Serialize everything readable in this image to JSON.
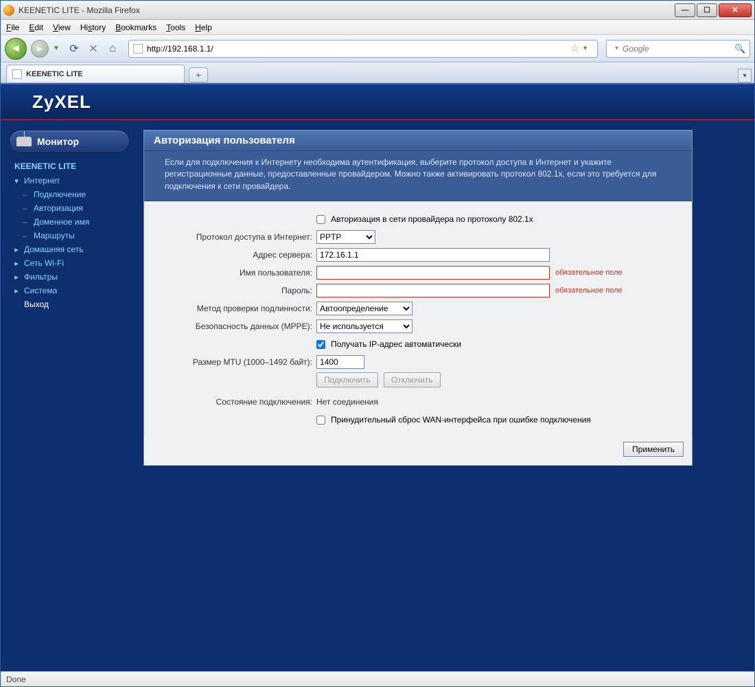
{
  "window": {
    "title": "KEENETIC LITE - Mozilla Firefox",
    "min": "—",
    "max": "☐",
    "close": "✕"
  },
  "menubar": [
    "File",
    "Edit",
    "View",
    "History",
    "Bookmarks",
    "Tools",
    "Help"
  ],
  "navbar": {
    "url": "http://192.168.1.1/",
    "search_placeholder": "Google"
  },
  "tab": {
    "title": "KEENETIC LITE",
    "add": "+"
  },
  "brand": "ZyXEL",
  "sidebar": {
    "monitor": "Монитор",
    "root": "KEENETIC LITE",
    "items": [
      {
        "label": "Интернет",
        "type": "branch",
        "expanded": true
      },
      {
        "label": "Подключение",
        "type": "leaf"
      },
      {
        "label": "Авторизация",
        "type": "leaf",
        "active": true
      },
      {
        "label": "Доменное имя",
        "type": "leaf"
      },
      {
        "label": "Маршруты",
        "type": "leaf"
      },
      {
        "label": "Домашняя сеть",
        "type": "branch"
      },
      {
        "label": "Сеть Wi-Fi",
        "type": "branch"
      },
      {
        "label": "Фильтры",
        "type": "branch"
      },
      {
        "label": "Система",
        "type": "branch"
      },
      {
        "label": "Выход",
        "type": "plain"
      }
    ]
  },
  "panel": {
    "title": "Авторизация пользователя",
    "desc": "Если для подключения к Интернету необходима аутентификация, выберите протокол доступа в Интернет и укажите регистрационные данные, предоставленные провайдером. Можно также активировать протокол 802.1x, если это требуется для подключения к сети провайдера."
  },
  "form": {
    "chk_8021x_label": "Авторизация в сети провайдера по протоколу 802.1x",
    "protocol_label": "Протокол доступа в Интернет:",
    "protocol_value": "PPTP",
    "server_label": "Адрес сервера:",
    "server_value": "172.16.1.1",
    "username_label": "Имя пользователя:",
    "username_value": "",
    "password_label": "Пароль:",
    "password_value": "",
    "required_text": "обязательное поле",
    "auth_method_label": "Метод проверки подлинности:",
    "auth_method_value": "Автоопределение",
    "mppe_label": "Безопасность данных (MPPE):",
    "mppe_value": "Не используется",
    "auto_ip_label": "Получать IP-адрес автоматически",
    "mtu_label": "Размер MTU (1000–1492 байт):",
    "mtu_value": "1400",
    "btn_connect": "Подключить",
    "btn_disconnect": "Отключить",
    "conn_state_label": "Состояние подключения:",
    "conn_state_value": "Нет соединения",
    "force_reset_label": "Принудительный сброс WAN-интерфейса при ошибке подключения",
    "apply": "Применить"
  },
  "statusbar": "Done"
}
